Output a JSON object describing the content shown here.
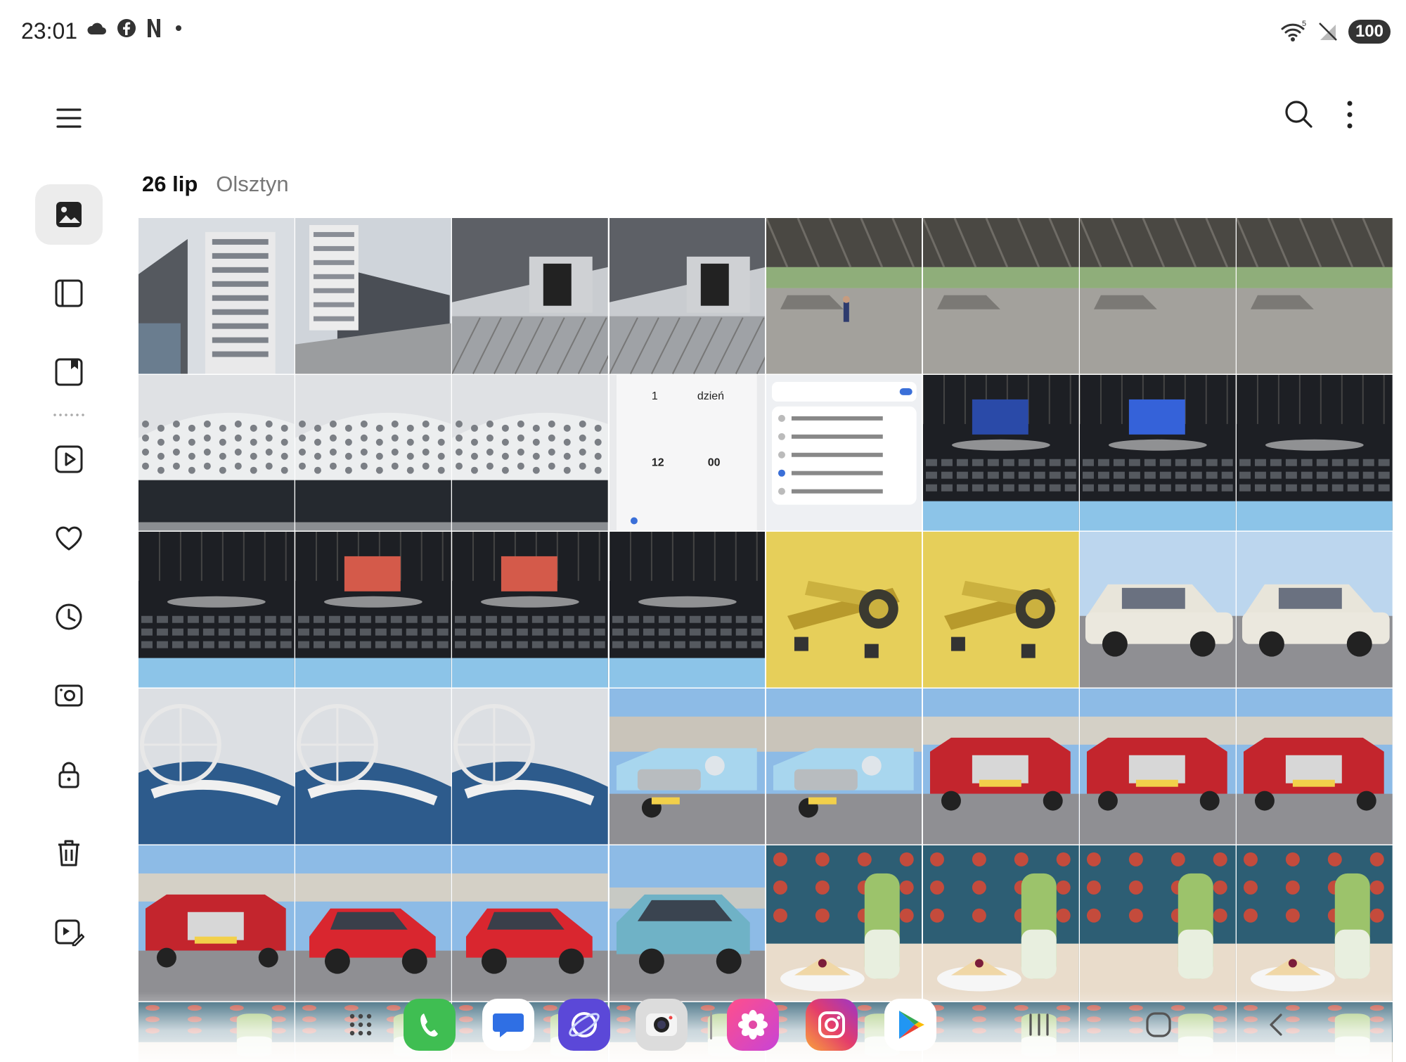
{
  "status_bar": {
    "time": "23:01",
    "battery": "100",
    "wifi_label": "5",
    "left_icons": [
      "cloud-icon",
      "facebook-icon",
      "netflix-icon",
      "dot-icon"
    ],
    "right_icons": [
      "wifi-icon",
      "no-signal-icon"
    ]
  },
  "toolbar": {
    "menu_icon": "menu-icon",
    "search_icon": "search-icon",
    "more_icon": "more-vertical-icon"
  },
  "sidebar": {
    "items": [
      {
        "name": "pictures",
        "icon": "pictures-icon",
        "active": true
      },
      {
        "name": "albums",
        "icon": "albums-icon",
        "active": false
      },
      {
        "name": "stories",
        "icon": "stories-icon",
        "active": false
      },
      {
        "name": "videos",
        "icon": "video-icon",
        "active": false
      },
      {
        "name": "favorites",
        "icon": "heart-icon",
        "active": false
      },
      {
        "name": "recent",
        "icon": "clock-icon",
        "active": false
      },
      {
        "name": "screenshots",
        "icon": "screenshot-icon",
        "active": false
      },
      {
        "name": "secure-folder",
        "icon": "lock-icon",
        "active": false
      },
      {
        "name": "trash",
        "icon": "trash-icon",
        "active": false
      },
      {
        "name": "edit",
        "icon": "edit-video-icon",
        "active": false
      }
    ]
  },
  "gallery": {
    "date": "26 lip",
    "location": "Olsztyn"
  },
  "dock": {
    "apps": [
      "apps-icon",
      "phone-icon",
      "messages-icon",
      "internet-icon",
      "camera-icon",
      "gallery-icon",
      "instagram-icon",
      "play-store-icon"
    ],
    "nav": [
      "recents-icon",
      "home-icon",
      "back-icon"
    ]
  },
  "colors": {
    "accent": "#3a6fd8",
    "rail_active_bg": "#ececec",
    "text_primary": "#111111",
    "text_secondary": "#777777"
  }
}
